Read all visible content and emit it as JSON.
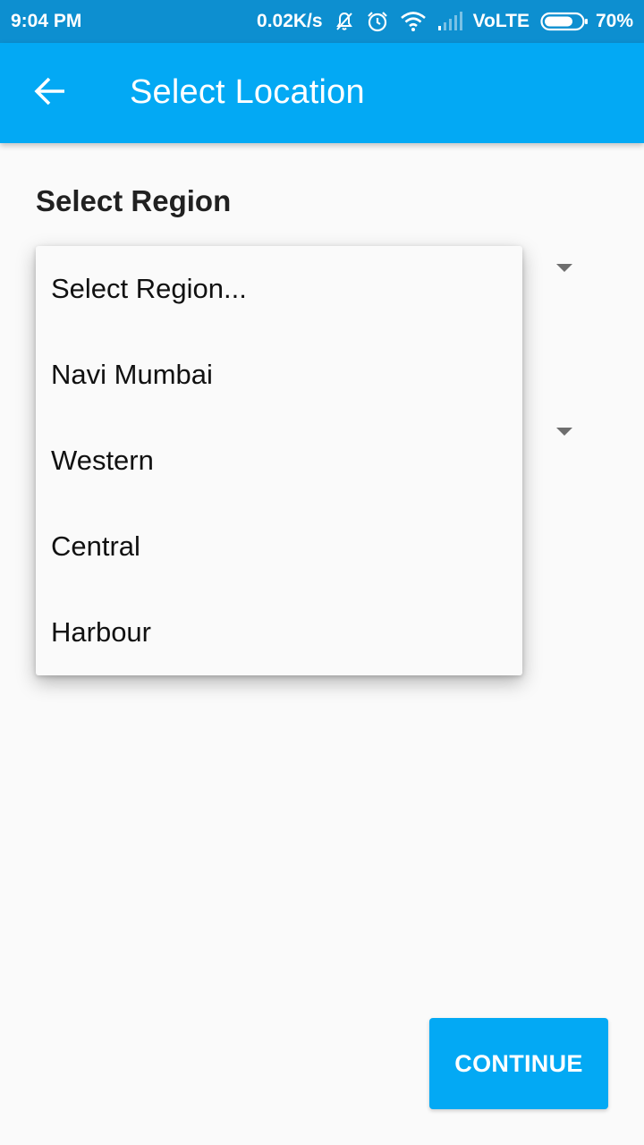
{
  "status_bar": {
    "time": "9:04 PM",
    "network_speed": "0.02K/s",
    "network_type": "VoLTE",
    "battery": "70%",
    "icons": [
      "mute-notification-icon",
      "alarm-icon",
      "wifi-icon",
      "signal-icon",
      "battery-icon"
    ]
  },
  "app_bar": {
    "title": "Select Location",
    "back_icon": "arrow-back-icon",
    "color": "#03a9f4"
  },
  "form": {
    "region_label": "Select Region"
  },
  "region_dropdown": {
    "options": [
      {
        "label": "Select Region..."
      },
      {
        "label": "Navi Mumbai"
      },
      {
        "label": "Western"
      },
      {
        "label": "Central"
      },
      {
        "label": "Harbour"
      }
    ]
  },
  "continue_button": {
    "label": "CONTINUE",
    "color": "#03a9f4"
  }
}
